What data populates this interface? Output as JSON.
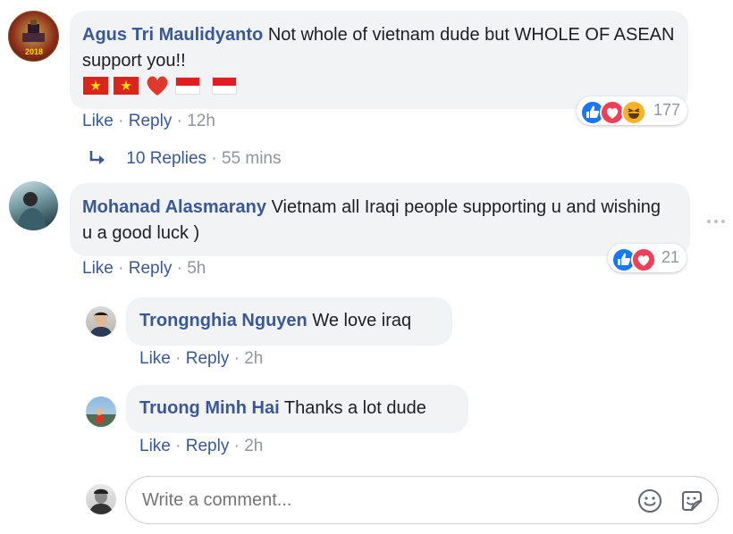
{
  "comments": [
    {
      "author": "Agus Tri Maulidyanto",
      "text": "Not whole of vietnam dude but WHOLE OF ASEAN support you!!",
      "avatar_text": "2018",
      "actions": {
        "like": "Like",
        "reply": "Reply",
        "time": "12h"
      },
      "reactions": {
        "icons": [
          "like-icon",
          "love-icon",
          "haha-icon"
        ],
        "count": "177"
      },
      "replies_link": {
        "label": "10 Replies",
        "time": "55 mins"
      }
    },
    {
      "author": "Mohanad Alasmarany",
      "text": "Vietnam all Iraqi people supporting u and wishing u a good luck )",
      "actions": {
        "like": "Like",
        "reply": "Reply",
        "time": "5h"
      },
      "reactions": {
        "icons": [
          "like-icon",
          "love-icon"
        ],
        "count": "21"
      }
    }
  ],
  "replies": [
    {
      "author": "Trongnghia Nguyen",
      "text": "We love iraq",
      "actions": {
        "like": "Like",
        "reply": "Reply",
        "time": "2h"
      }
    },
    {
      "author": "Truong Minh Hai",
      "text": "Thanks a lot dude",
      "actions": {
        "like": "Like",
        "reply": "Reply",
        "time": "2h"
      }
    }
  ],
  "separator": "·",
  "composer": {
    "placeholder": "Write a comment...",
    "icons": [
      "emoji-icon",
      "sticker-icon"
    ]
  },
  "colors": {
    "link": "#385898",
    "meta": "#90949c",
    "bubble": "#f2f3f5",
    "like": "#1877f2",
    "love": "#f33e58",
    "haha": "#f7b125"
  }
}
